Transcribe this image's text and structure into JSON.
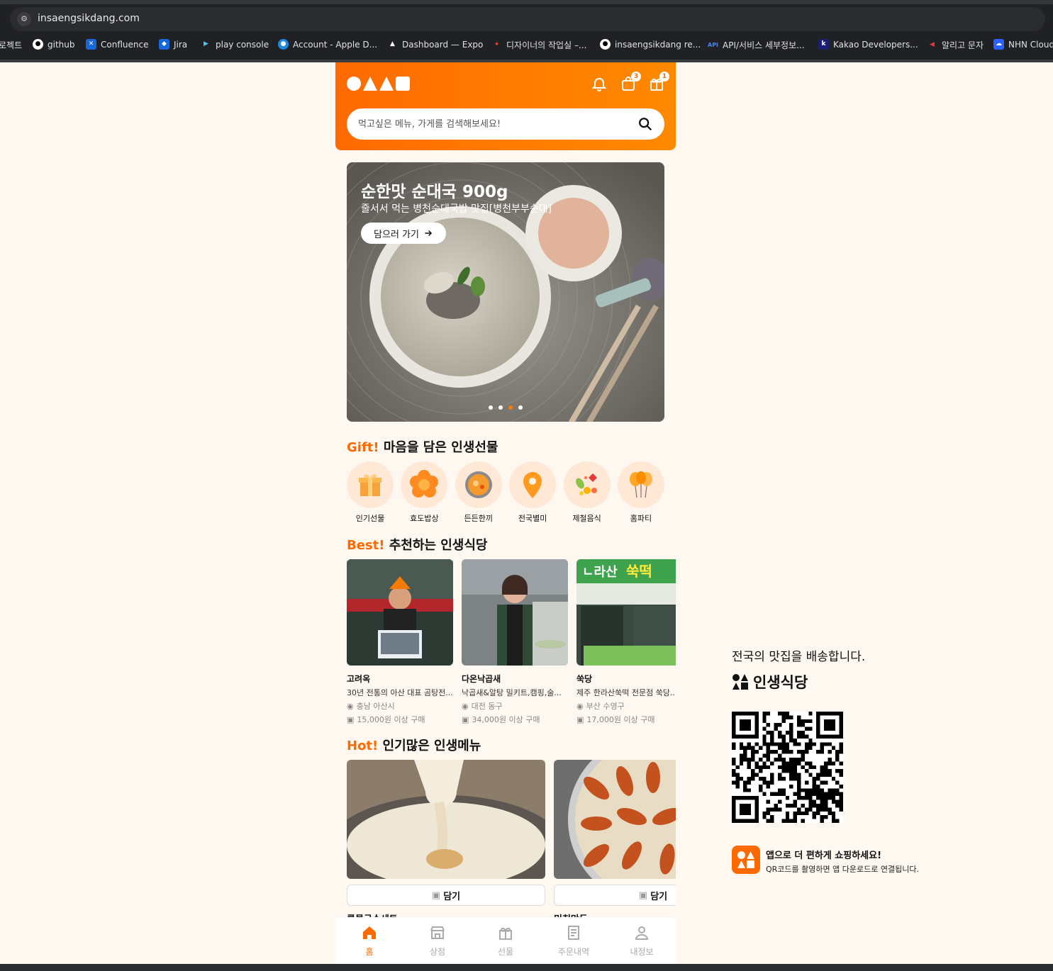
{
  "browser": {
    "url": "insaengsikdang.com",
    "bookmarks": [
      {
        "label": "로젝트",
        "icon": "folder-icon",
        "color": "#5f6368"
      },
      {
        "label": "github",
        "icon": "github-icon",
        "color": "#ffffff"
      },
      {
        "label": "Confluence",
        "icon": "confluence-icon",
        "color": "#1868db"
      },
      {
        "label": "Jira",
        "icon": "jira-icon",
        "color": "#1868db"
      },
      {
        "label": "play console",
        "icon": "play-console-icon",
        "color": "#1a73e8"
      },
      {
        "label": "Account - Apple D...",
        "icon": "apple-developer-icon",
        "color": "#1e88e5"
      },
      {
        "label": "Dashboard — Expo",
        "icon": "expo-icon",
        "color": "#ffffff"
      },
      {
        "label": "디자이너의 작업실 –...",
        "icon": "figma-icon",
        "color": "#a259ff"
      },
      {
        "label": "insaengsikdang re...",
        "icon": "github-icon",
        "color": "#ffffff"
      },
      {
        "label": "API/서비스 세부정보...",
        "icon": "api-icon",
        "color": "#4285f4"
      },
      {
        "label": "Kakao Developers...",
        "icon": "kakao-icon",
        "color": "#1a1f71"
      },
      {
        "label": "알리고 문자",
        "icon": "aligo-icon",
        "color": "#e53935"
      },
      {
        "label": "NHN Cloud",
        "icon": "nhn-cloud-icon",
        "color": "#2962ff"
      }
    ]
  },
  "header": {
    "cart_badge": "3",
    "gift_badge": "1",
    "search_placeholder": "먹고싶은 메뉴, 가게를 검색해보세요!"
  },
  "banner": {
    "title": "순한맛 순대국 900g",
    "subtitle": "줄서서 먹는 병천순대국밥 맛집[병천부부순대]",
    "button": "담으러 가기",
    "slide_count": 4,
    "active_slide": 2
  },
  "gift_section": {
    "accent": "Gift!",
    "title": " 마음을 담은 인생선물",
    "items": [
      {
        "label": "인기선물",
        "icon": "gift-box-icon"
      },
      {
        "label": "효도밥상",
        "icon": "flower-icon"
      },
      {
        "label": "든든한끼",
        "icon": "bowl-icon"
      },
      {
        "label": "전국별미",
        "icon": "location-pin-icon"
      },
      {
        "label": "제철음식",
        "icon": "seasonal-leaves-icon"
      },
      {
        "label": "홈파티",
        "icon": "balloons-icon"
      }
    ]
  },
  "best_section": {
    "accent": "Best!",
    "title": " 추천하는 인생식당",
    "stores": [
      {
        "name": "고려옥",
        "desc": "30년 전통의 아산 대표 곰탕전...",
        "location": "충남 아산시",
        "min_order": "15,000원 이상 구매"
      },
      {
        "name": "다온낙곱새",
        "desc": "낙곱새&알탕 밀키트,캠핑,술...",
        "location": "대전 동구",
        "min_order": "34,000원 이상 구매"
      },
      {
        "name": "쑥당",
        "desc": "제주 한라산쑥떡 전문점 쑥당...",
        "location": "부산 수영구",
        "min_order": "17,000원 이상 구매"
      }
    ]
  },
  "hot_section": {
    "accent": "Hot!",
    "title": " 인기많은 인생메뉴",
    "menus": [
      {
        "name": "콩물국수세트",
        "cart_label": "담기"
      },
      {
        "name": "미친만두",
        "cart_label": "담기"
      }
    ]
  },
  "bottom_nav": [
    {
      "label": "홈",
      "icon": "home-icon",
      "active": true
    },
    {
      "label": "상점",
      "icon": "store-icon",
      "active": false
    },
    {
      "label": "선물",
      "icon": "gift-icon",
      "active": false
    },
    {
      "label": "주문내역",
      "icon": "receipt-icon",
      "active": false
    },
    {
      "label": "내정보",
      "icon": "user-icon",
      "active": false
    }
  ],
  "side_panel": {
    "tagline": "전국의 맛집을 배송합니다.",
    "brand": "인생식당",
    "promo_title": "앱으로 더 편하게 쇼핑하세요!",
    "promo_sub": "QR코드를 촬영하면 앱 다운로드로 연결됩니다."
  },
  "colors": {
    "brand": "#ff6a00",
    "background": "#fff8f1"
  }
}
